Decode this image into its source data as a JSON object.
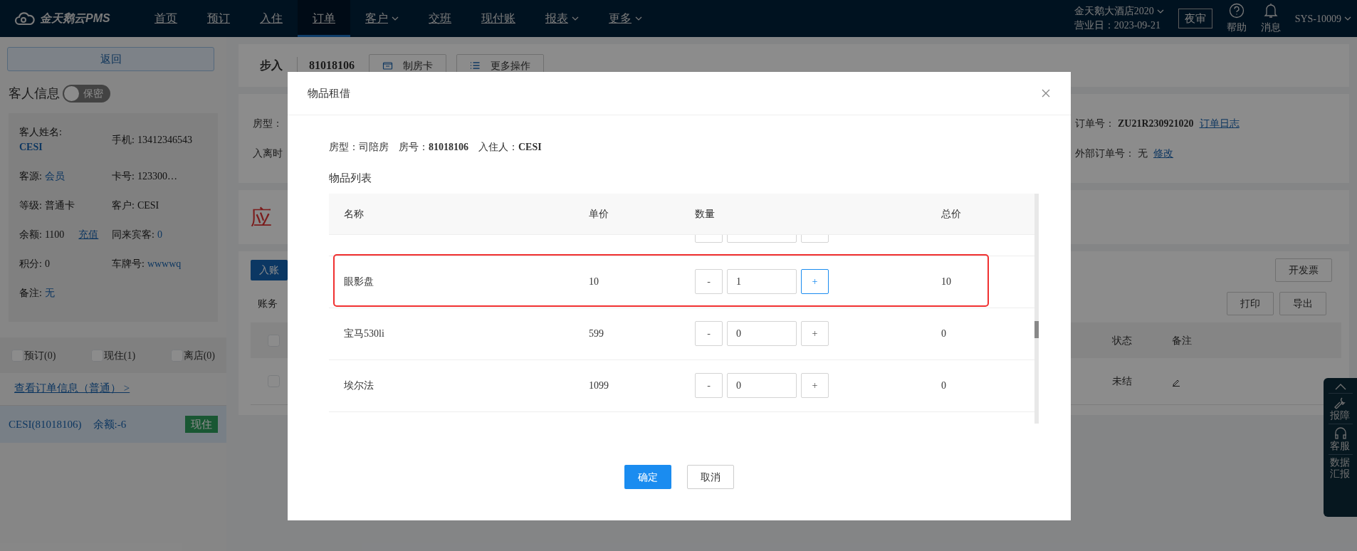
{
  "navbar": {
    "logo": "金天鹅云PMS",
    "items": [
      {
        "label": "首页",
        "selected": false,
        "dropdown": false
      },
      {
        "label": "预订",
        "selected": false,
        "dropdown": false
      },
      {
        "label": "入住",
        "selected": false,
        "dropdown": false
      },
      {
        "label": "订单",
        "selected": true,
        "dropdown": false
      },
      {
        "label": "客户",
        "selected": false,
        "dropdown": true
      },
      {
        "label": "交班",
        "selected": false,
        "dropdown": false
      },
      {
        "label": "现付账",
        "selected": false,
        "dropdown": false
      },
      {
        "label": "报表",
        "selected": false,
        "dropdown": true
      },
      {
        "label": "更多",
        "selected": false,
        "dropdown": true
      }
    ],
    "hotel": "金天鹅大酒店2020",
    "business_day": "营业日：2023-09-21",
    "night_audit": "夜审",
    "help": "帮助",
    "messages": "消息",
    "user": "SYS-10009"
  },
  "sidebar": {
    "back": "返回",
    "guest_title": "客人信息",
    "privacy_toggle": {
      "label": "保密",
      "on": false
    },
    "fields": [
      {
        "label": "客人姓名:",
        "value": "CESI",
        "link": true,
        "stacked": true
      },
      {
        "label": "手机:",
        "value": "13412346543",
        "link": false,
        "stacked": false
      },
      {
        "label": "客源:",
        "value": "会员",
        "link": true,
        "stacked": false
      },
      {
        "label": "卡号:",
        "value": "123300…",
        "link": false,
        "stacked": false
      },
      {
        "label": "等级:",
        "value": "普通卡",
        "link": false,
        "stacked": false
      },
      {
        "label": "客户:",
        "value": "CESI",
        "link": false,
        "stacked": false
      },
      {
        "label": "余额:",
        "value": "1100",
        "link": false,
        "stacked": false,
        "action": "充值"
      },
      {
        "label": "同来宾客:",
        "value": "0",
        "link": true,
        "stacked": false
      },
      {
        "label": "积分:",
        "value": "0",
        "link": false,
        "stacked": false
      },
      {
        "label": "车牌号:",
        "value": "wwwwq",
        "link": true,
        "stacked": false
      },
      {
        "label": "备注:",
        "value": "无",
        "link": true,
        "stacked": false
      }
    ],
    "filters": [
      {
        "label": "预订(0)",
        "checked": false
      },
      {
        "label": "现住(1)",
        "checked": false
      },
      {
        "label": "离店(0)",
        "checked": false
      }
    ],
    "order_info_link": "查看订单信息（普通） >",
    "guests": [
      {
        "name": "CESI(81018106)",
        "balance": "余额:-6",
        "status": "现住",
        "selected": true
      }
    ]
  },
  "main": {
    "entry": "步入",
    "room_no": "81018106",
    "actions": [
      "制房卡",
      "更多操作"
    ],
    "info_left": [
      "房型：",
      "入离时"
    ],
    "info_right": [
      {
        "label": "订单号：",
        "value": "ZU21R230921020",
        "link": "订单日志"
      },
      {
        "label": "外部订单号：",
        "value": "无",
        "link": "修改"
      }
    ],
    "receivable": "应",
    "ledger": {
      "post_button": "入账",
      "invoice_button": "开发票",
      "section_label": "账务",
      "print": "打印",
      "export": "导出",
      "select_all_checked": false,
      "columns": [
        "状态",
        "备注"
      ],
      "rows": [
        {
          "checked": false,
          "status": "未结"
        }
      ]
    }
  },
  "float_bar": [
    "报障",
    "客服",
    "数据汇报"
  ],
  "modal": {
    "title": "物品租借",
    "info": [
      {
        "label": "房型：",
        "value": "司陪房",
        "bold": false
      },
      {
        "label": "房号：",
        "value": "81018106",
        "bold": true
      },
      {
        "label": "入住人：",
        "value": "CESI",
        "bold": true
      }
    ],
    "list_title": "物品列表",
    "columns": [
      "名称",
      "单价",
      "数量",
      "总价"
    ],
    "rows": [
      {
        "kind": "clipped"
      },
      {
        "kind": "item",
        "name": "眼影盘",
        "price": "10",
        "minus": "-",
        "quantity": "1",
        "plus": "+",
        "total": "10",
        "focused": true,
        "highlighted": true
      },
      {
        "kind": "item",
        "name": "宝马530li",
        "price": "599",
        "minus": "-",
        "quantity": "0",
        "plus": "+",
        "total": "0",
        "focused": false,
        "highlighted": false
      },
      {
        "kind": "item",
        "name": "埃尔法",
        "price": "1099",
        "minus": "-",
        "quantity": "0",
        "plus": "+",
        "total": "0",
        "focused": false,
        "highlighted": false
      }
    ],
    "confirm": "确定",
    "cancel": "取消"
  }
}
